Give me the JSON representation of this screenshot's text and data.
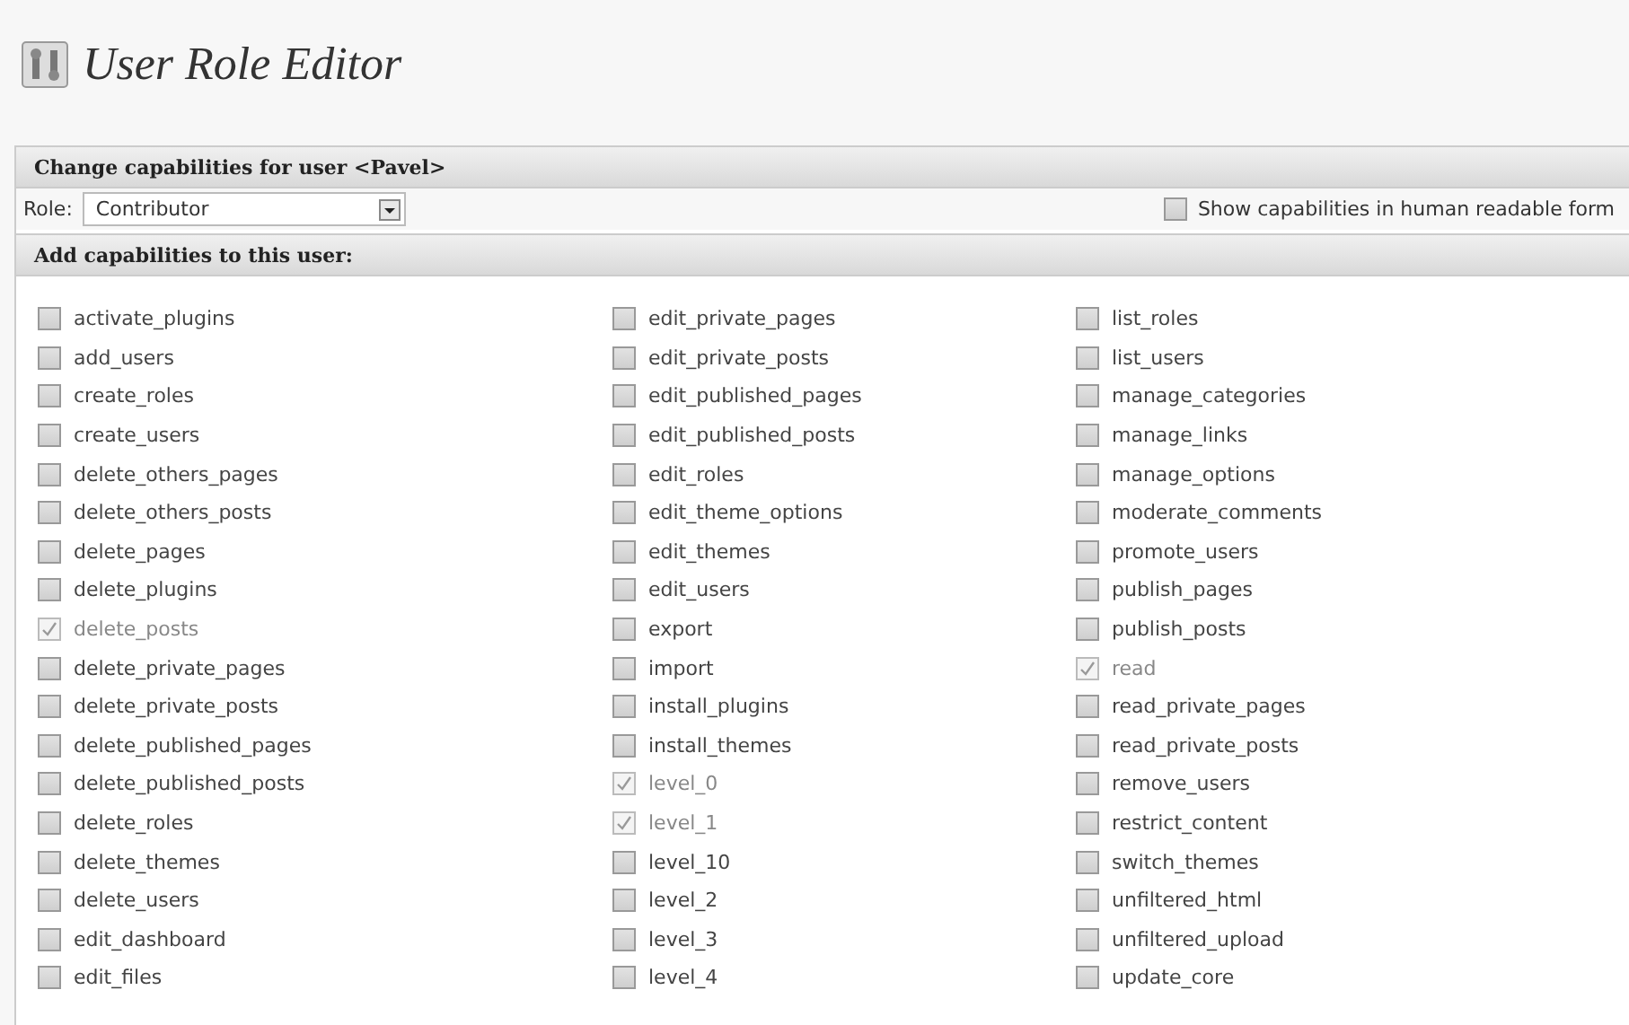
{
  "page_title": "User Role Editor",
  "panel": {
    "heading": "Change capabilities for user <Pavel>",
    "role_label": "Role:",
    "role_value": "Contributor",
    "human_readable": {
      "label": "Show capabilities in human readable form",
      "checked": false
    }
  },
  "capabilities_section": {
    "heading": "Add capabilities to this user:",
    "columns": [
      [
        {
          "label": "activate_plugins",
          "checked": false
        },
        {
          "label": "add_users",
          "checked": false
        },
        {
          "label": "create_roles",
          "checked": false
        },
        {
          "label": "create_users",
          "checked": false
        },
        {
          "label": "delete_others_pages",
          "checked": false
        },
        {
          "label": "delete_others_posts",
          "checked": false
        },
        {
          "label": "delete_pages",
          "checked": false
        },
        {
          "label": "delete_plugins",
          "checked": false
        },
        {
          "label": "delete_posts",
          "checked": true
        },
        {
          "label": "delete_private_pages",
          "checked": false
        },
        {
          "label": "delete_private_posts",
          "checked": false
        },
        {
          "label": "delete_published_pages",
          "checked": false
        },
        {
          "label": "delete_published_posts",
          "checked": false
        },
        {
          "label": "delete_roles",
          "checked": false
        },
        {
          "label": "delete_themes",
          "checked": false
        },
        {
          "label": "delete_users",
          "checked": false
        },
        {
          "label": "edit_dashboard",
          "checked": false
        },
        {
          "label": "edit_files",
          "checked": false
        }
      ],
      [
        {
          "label": "edit_private_pages",
          "checked": false
        },
        {
          "label": "edit_private_posts",
          "checked": false
        },
        {
          "label": "edit_published_pages",
          "checked": false
        },
        {
          "label": "edit_published_posts",
          "checked": false
        },
        {
          "label": "edit_roles",
          "checked": false
        },
        {
          "label": "edit_theme_options",
          "checked": false
        },
        {
          "label": "edit_themes",
          "checked": false
        },
        {
          "label": "edit_users",
          "checked": false
        },
        {
          "label": "export",
          "checked": false
        },
        {
          "label": "import",
          "checked": false
        },
        {
          "label": "install_plugins",
          "checked": false
        },
        {
          "label": "install_themes",
          "checked": false
        },
        {
          "label": "level_0",
          "checked": true
        },
        {
          "label": "level_1",
          "checked": true
        },
        {
          "label": "level_10",
          "checked": false
        },
        {
          "label": "level_2",
          "checked": false
        },
        {
          "label": "level_3",
          "checked": false
        },
        {
          "label": "level_4",
          "checked": false
        }
      ],
      [
        {
          "label": "list_roles",
          "checked": false
        },
        {
          "label": "list_users",
          "checked": false
        },
        {
          "label": "manage_categories",
          "checked": false
        },
        {
          "label": "manage_links",
          "checked": false
        },
        {
          "label": "manage_options",
          "checked": false
        },
        {
          "label": "moderate_comments",
          "checked": false
        },
        {
          "label": "promote_users",
          "checked": false
        },
        {
          "label": "publish_pages",
          "checked": false
        },
        {
          "label": "publish_posts",
          "checked": false
        },
        {
          "label": "read",
          "checked": true
        },
        {
          "label": "read_private_pages",
          "checked": false
        },
        {
          "label": "read_private_posts",
          "checked": false
        },
        {
          "label": "remove_users",
          "checked": false
        },
        {
          "label": "restrict_content",
          "checked": false
        },
        {
          "label": "switch_themes",
          "checked": false
        },
        {
          "label": "unfiltered_html",
          "checked": false
        },
        {
          "label": "unfiltered_upload",
          "checked": false
        },
        {
          "label": "update_core",
          "checked": false
        }
      ]
    ]
  }
}
